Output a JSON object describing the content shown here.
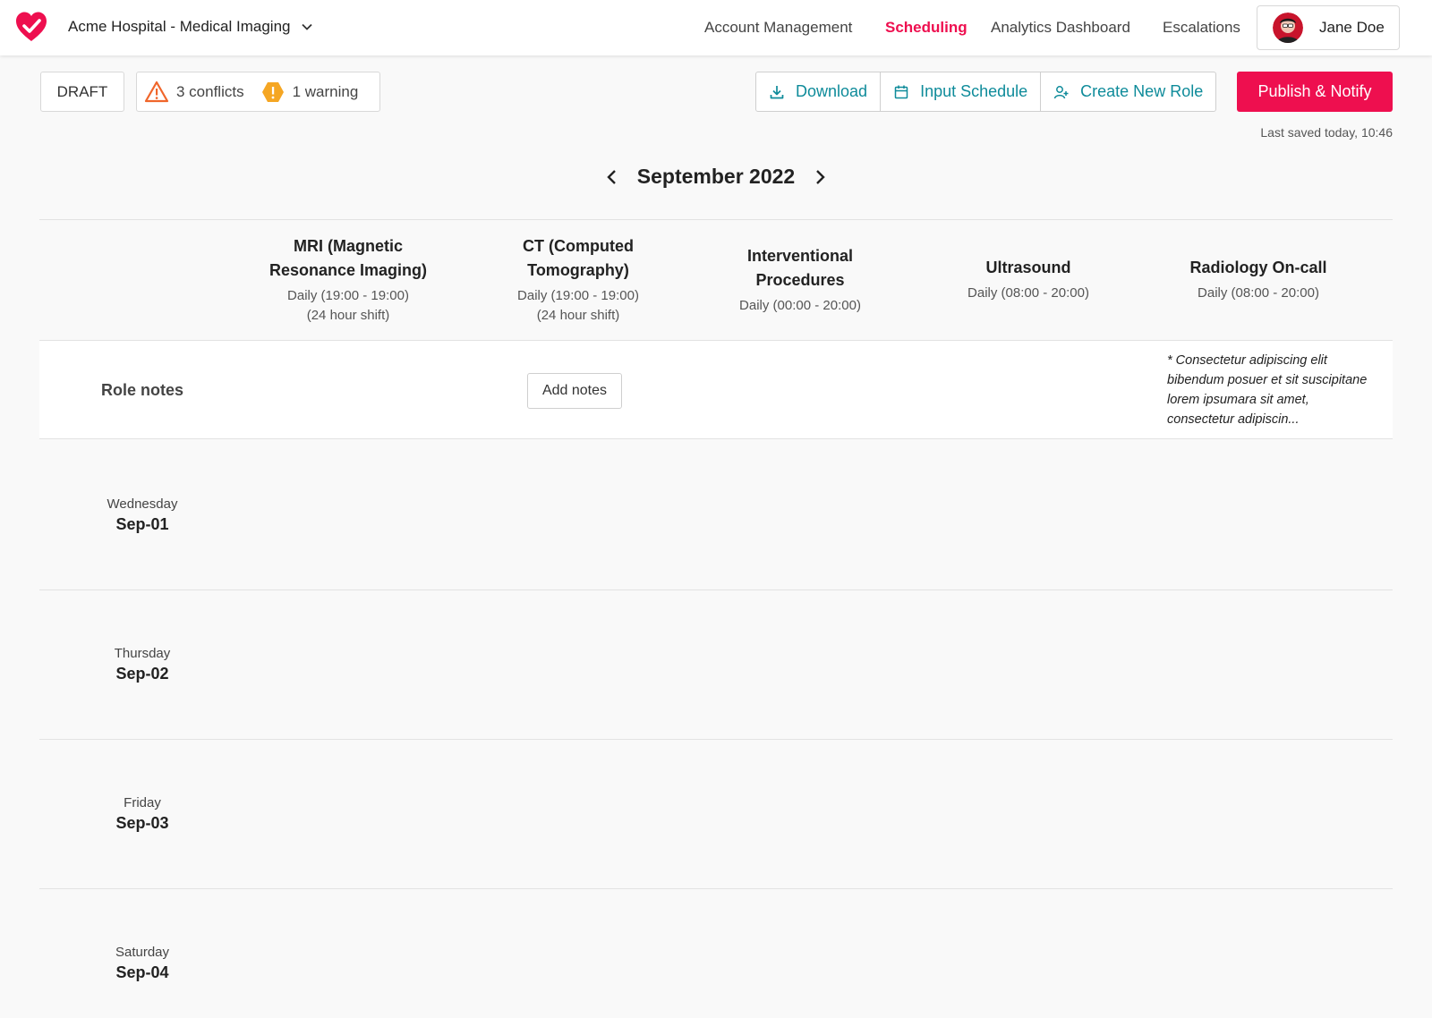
{
  "header": {
    "org_name": "Acme Hospital - Medical Imaging",
    "nav": [
      {
        "label": "Account Management",
        "active": false
      },
      {
        "label": "Scheduling",
        "active": true
      },
      {
        "label": "Analytics Dashboard",
        "active": false
      },
      {
        "label": "Escalations",
        "active": false
      }
    ],
    "user_name": "Jane Doe",
    "accent_color": "#ee0f4f"
  },
  "toolbar": {
    "status": "DRAFT",
    "conflicts": "3 conflicts",
    "warnings": "1 warning",
    "download_label": "Download",
    "input_schedule_label": "Input Schedule",
    "create_role_label": "Create New Role",
    "publish_label": "Publish & Notify",
    "last_saved": "Last saved today, 10:46"
  },
  "calendar": {
    "month": "September 2022",
    "columns": [
      {
        "title": "MRI (Magnetic Resonance Imaging)",
        "schedule": "Daily (19:00 - 19:00)",
        "note": "(24 hour shift)"
      },
      {
        "title": "CT (Computed Tomography)",
        "schedule": "Daily (19:00 - 19:00)",
        "note": "(24 hour shift)"
      },
      {
        "title": "Interventional Procedures",
        "schedule": "Daily (00:00 - 20:00)",
        "note": ""
      },
      {
        "title": "Ultrasound",
        "schedule": "Daily (08:00 - 20:00)",
        "note": ""
      },
      {
        "title": "Radiology On-call",
        "schedule": "Daily (08:00 - 20:00)",
        "note": ""
      }
    ],
    "role_notes_label": "Role notes",
    "add_notes_label": "Add notes",
    "radiology_note": "* Consectetur adipiscing elit bibendum posuer et sit suscipitane lorem ipsumara sit amet, consectetur adipiscin...",
    "days": [
      {
        "weekday": "Wednesday",
        "date": "Sep-01"
      },
      {
        "weekday": "Thursday",
        "date": "Sep-02"
      },
      {
        "weekday": "Friday",
        "date": "Sep-03"
      },
      {
        "weekday": "Saturday",
        "date": "Sep-04"
      }
    ]
  }
}
